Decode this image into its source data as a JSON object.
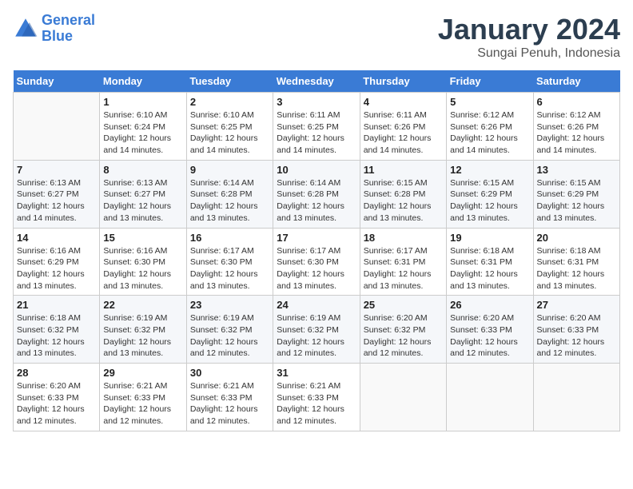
{
  "header": {
    "logo_text_general": "General",
    "logo_text_blue": "Blue",
    "title": "January 2024",
    "subtitle": "Sungai Penuh, Indonesia"
  },
  "calendar": {
    "days_of_week": [
      "Sunday",
      "Monday",
      "Tuesday",
      "Wednesday",
      "Thursday",
      "Friday",
      "Saturday"
    ],
    "weeks": [
      [
        {
          "day": "",
          "info": ""
        },
        {
          "day": "1",
          "info": "Sunrise: 6:10 AM\nSunset: 6:24 PM\nDaylight: 12 hours\nand 14 minutes."
        },
        {
          "day": "2",
          "info": "Sunrise: 6:10 AM\nSunset: 6:25 PM\nDaylight: 12 hours\nand 14 minutes."
        },
        {
          "day": "3",
          "info": "Sunrise: 6:11 AM\nSunset: 6:25 PM\nDaylight: 12 hours\nand 14 minutes."
        },
        {
          "day": "4",
          "info": "Sunrise: 6:11 AM\nSunset: 6:26 PM\nDaylight: 12 hours\nand 14 minutes."
        },
        {
          "day": "5",
          "info": "Sunrise: 6:12 AM\nSunset: 6:26 PM\nDaylight: 12 hours\nand 14 minutes."
        },
        {
          "day": "6",
          "info": "Sunrise: 6:12 AM\nSunset: 6:26 PM\nDaylight: 12 hours\nand 14 minutes."
        }
      ],
      [
        {
          "day": "7",
          "info": "Sunrise: 6:13 AM\nSunset: 6:27 PM\nDaylight: 12 hours\nand 14 minutes."
        },
        {
          "day": "8",
          "info": "Sunrise: 6:13 AM\nSunset: 6:27 PM\nDaylight: 12 hours\nand 13 minutes."
        },
        {
          "day": "9",
          "info": "Sunrise: 6:14 AM\nSunset: 6:28 PM\nDaylight: 12 hours\nand 13 minutes."
        },
        {
          "day": "10",
          "info": "Sunrise: 6:14 AM\nSunset: 6:28 PM\nDaylight: 12 hours\nand 13 minutes."
        },
        {
          "day": "11",
          "info": "Sunrise: 6:15 AM\nSunset: 6:28 PM\nDaylight: 12 hours\nand 13 minutes."
        },
        {
          "day": "12",
          "info": "Sunrise: 6:15 AM\nSunset: 6:29 PM\nDaylight: 12 hours\nand 13 minutes."
        },
        {
          "day": "13",
          "info": "Sunrise: 6:15 AM\nSunset: 6:29 PM\nDaylight: 12 hours\nand 13 minutes."
        }
      ],
      [
        {
          "day": "14",
          "info": "Sunrise: 6:16 AM\nSunset: 6:29 PM\nDaylight: 12 hours\nand 13 minutes."
        },
        {
          "day": "15",
          "info": "Sunrise: 6:16 AM\nSunset: 6:30 PM\nDaylight: 12 hours\nand 13 minutes."
        },
        {
          "day": "16",
          "info": "Sunrise: 6:17 AM\nSunset: 6:30 PM\nDaylight: 12 hours\nand 13 minutes."
        },
        {
          "day": "17",
          "info": "Sunrise: 6:17 AM\nSunset: 6:30 PM\nDaylight: 12 hours\nand 13 minutes."
        },
        {
          "day": "18",
          "info": "Sunrise: 6:17 AM\nSunset: 6:31 PM\nDaylight: 12 hours\nand 13 minutes."
        },
        {
          "day": "19",
          "info": "Sunrise: 6:18 AM\nSunset: 6:31 PM\nDaylight: 12 hours\nand 13 minutes."
        },
        {
          "day": "20",
          "info": "Sunrise: 6:18 AM\nSunset: 6:31 PM\nDaylight: 12 hours\nand 13 minutes."
        }
      ],
      [
        {
          "day": "21",
          "info": "Sunrise: 6:18 AM\nSunset: 6:32 PM\nDaylight: 12 hours\nand 13 minutes."
        },
        {
          "day": "22",
          "info": "Sunrise: 6:19 AM\nSunset: 6:32 PM\nDaylight: 12 hours\nand 13 minutes."
        },
        {
          "day": "23",
          "info": "Sunrise: 6:19 AM\nSunset: 6:32 PM\nDaylight: 12 hours\nand 12 minutes."
        },
        {
          "day": "24",
          "info": "Sunrise: 6:19 AM\nSunset: 6:32 PM\nDaylight: 12 hours\nand 12 minutes."
        },
        {
          "day": "25",
          "info": "Sunrise: 6:20 AM\nSunset: 6:32 PM\nDaylight: 12 hours\nand 12 minutes."
        },
        {
          "day": "26",
          "info": "Sunrise: 6:20 AM\nSunset: 6:33 PM\nDaylight: 12 hours\nand 12 minutes."
        },
        {
          "day": "27",
          "info": "Sunrise: 6:20 AM\nSunset: 6:33 PM\nDaylight: 12 hours\nand 12 minutes."
        }
      ],
      [
        {
          "day": "28",
          "info": "Sunrise: 6:20 AM\nSunset: 6:33 PM\nDaylight: 12 hours\nand 12 minutes."
        },
        {
          "day": "29",
          "info": "Sunrise: 6:21 AM\nSunset: 6:33 PM\nDaylight: 12 hours\nand 12 minutes."
        },
        {
          "day": "30",
          "info": "Sunrise: 6:21 AM\nSunset: 6:33 PM\nDaylight: 12 hours\nand 12 minutes."
        },
        {
          "day": "31",
          "info": "Sunrise: 6:21 AM\nSunset: 6:33 PM\nDaylight: 12 hours\nand 12 minutes."
        },
        {
          "day": "",
          "info": ""
        },
        {
          "day": "",
          "info": ""
        },
        {
          "day": "",
          "info": ""
        }
      ]
    ]
  }
}
